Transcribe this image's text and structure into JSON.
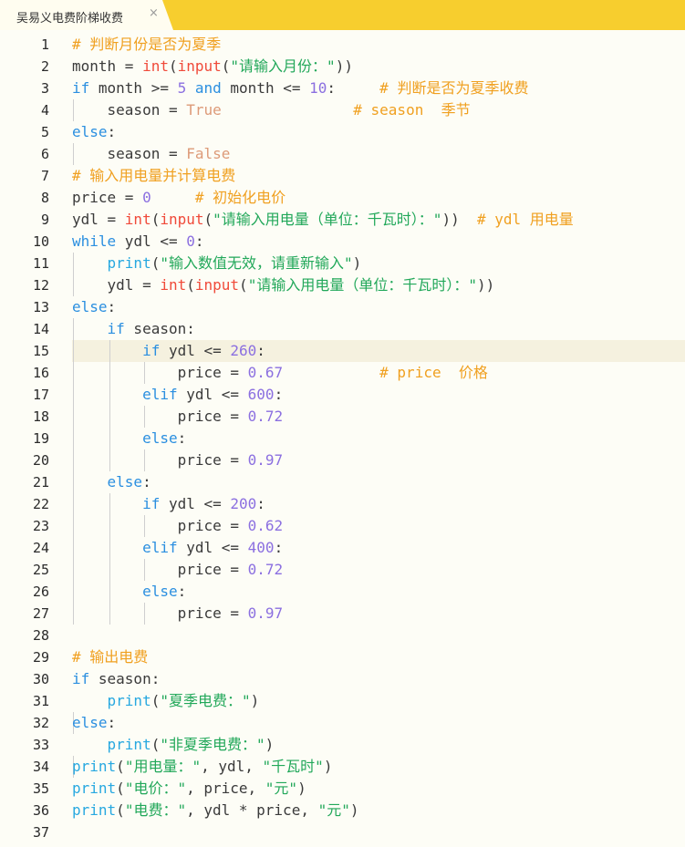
{
  "tab": {
    "title": "吴易义电费阶梯收费",
    "close_glyph": "×"
  },
  "line_numbers": [
    "1",
    "2",
    "3",
    "4",
    "5",
    "6",
    "7",
    "8",
    "9",
    "10",
    "11",
    "12",
    "13",
    "14",
    "15",
    "16",
    "17",
    "18",
    "19",
    "20",
    "21",
    "22",
    "23",
    "24",
    "25",
    "26",
    "27",
    "28",
    "29",
    "30",
    "31",
    "32",
    "33",
    "34",
    "35",
    "36",
    "37"
  ],
  "code": {
    "c1": "# 判断月份是否为夏季",
    "c3": "# 判断是否为夏季收费",
    "c4": "# season  季节",
    "c7": "# 输入用电量并计算电费",
    "c8": "# 初始化电价",
    "c9": "# ydl 用电量",
    "c16": "# price  价格",
    "c29": "# 输出电费",
    "s2": "\"请输入月份：\"",
    "s9": "\"请输入用电量（单位：千瓦时）：\"",
    "s11": "\"输入数值无效，请重新输入\"",
    "s12": "\"请输入用电量（单位：千瓦时）：\"",
    "s31": "\"夏季电费：\"",
    "s33": "\"非夏季电费：\"",
    "s34a": "\"用电量：\"",
    "s34b": "\"千瓦时\"",
    "s35a": "\"电价：\"",
    "s35b": "\"元\"",
    "s36a": "\"电费：\"",
    "s36b": "\"元\"",
    "n3a": "5",
    "n3b": "10",
    "n8": "0",
    "n10": "0",
    "n15": "260",
    "n16": "0.67",
    "n17": "600",
    "n18": "0.72",
    "n20": "0.97",
    "n22": "200",
    "n23": "0.62",
    "n24": "400",
    "n25": "0.72",
    "n27": "0.97",
    "true": "True",
    "false": "False"
  },
  "colors": {
    "tab_bar": "#f7ce2e",
    "keyword": "#2b8fe0",
    "function": "#f04a3a",
    "string": "#22a85a",
    "number": "#8b6fe0",
    "comment": "#f0a020",
    "constant": "#dd9a78"
  }
}
